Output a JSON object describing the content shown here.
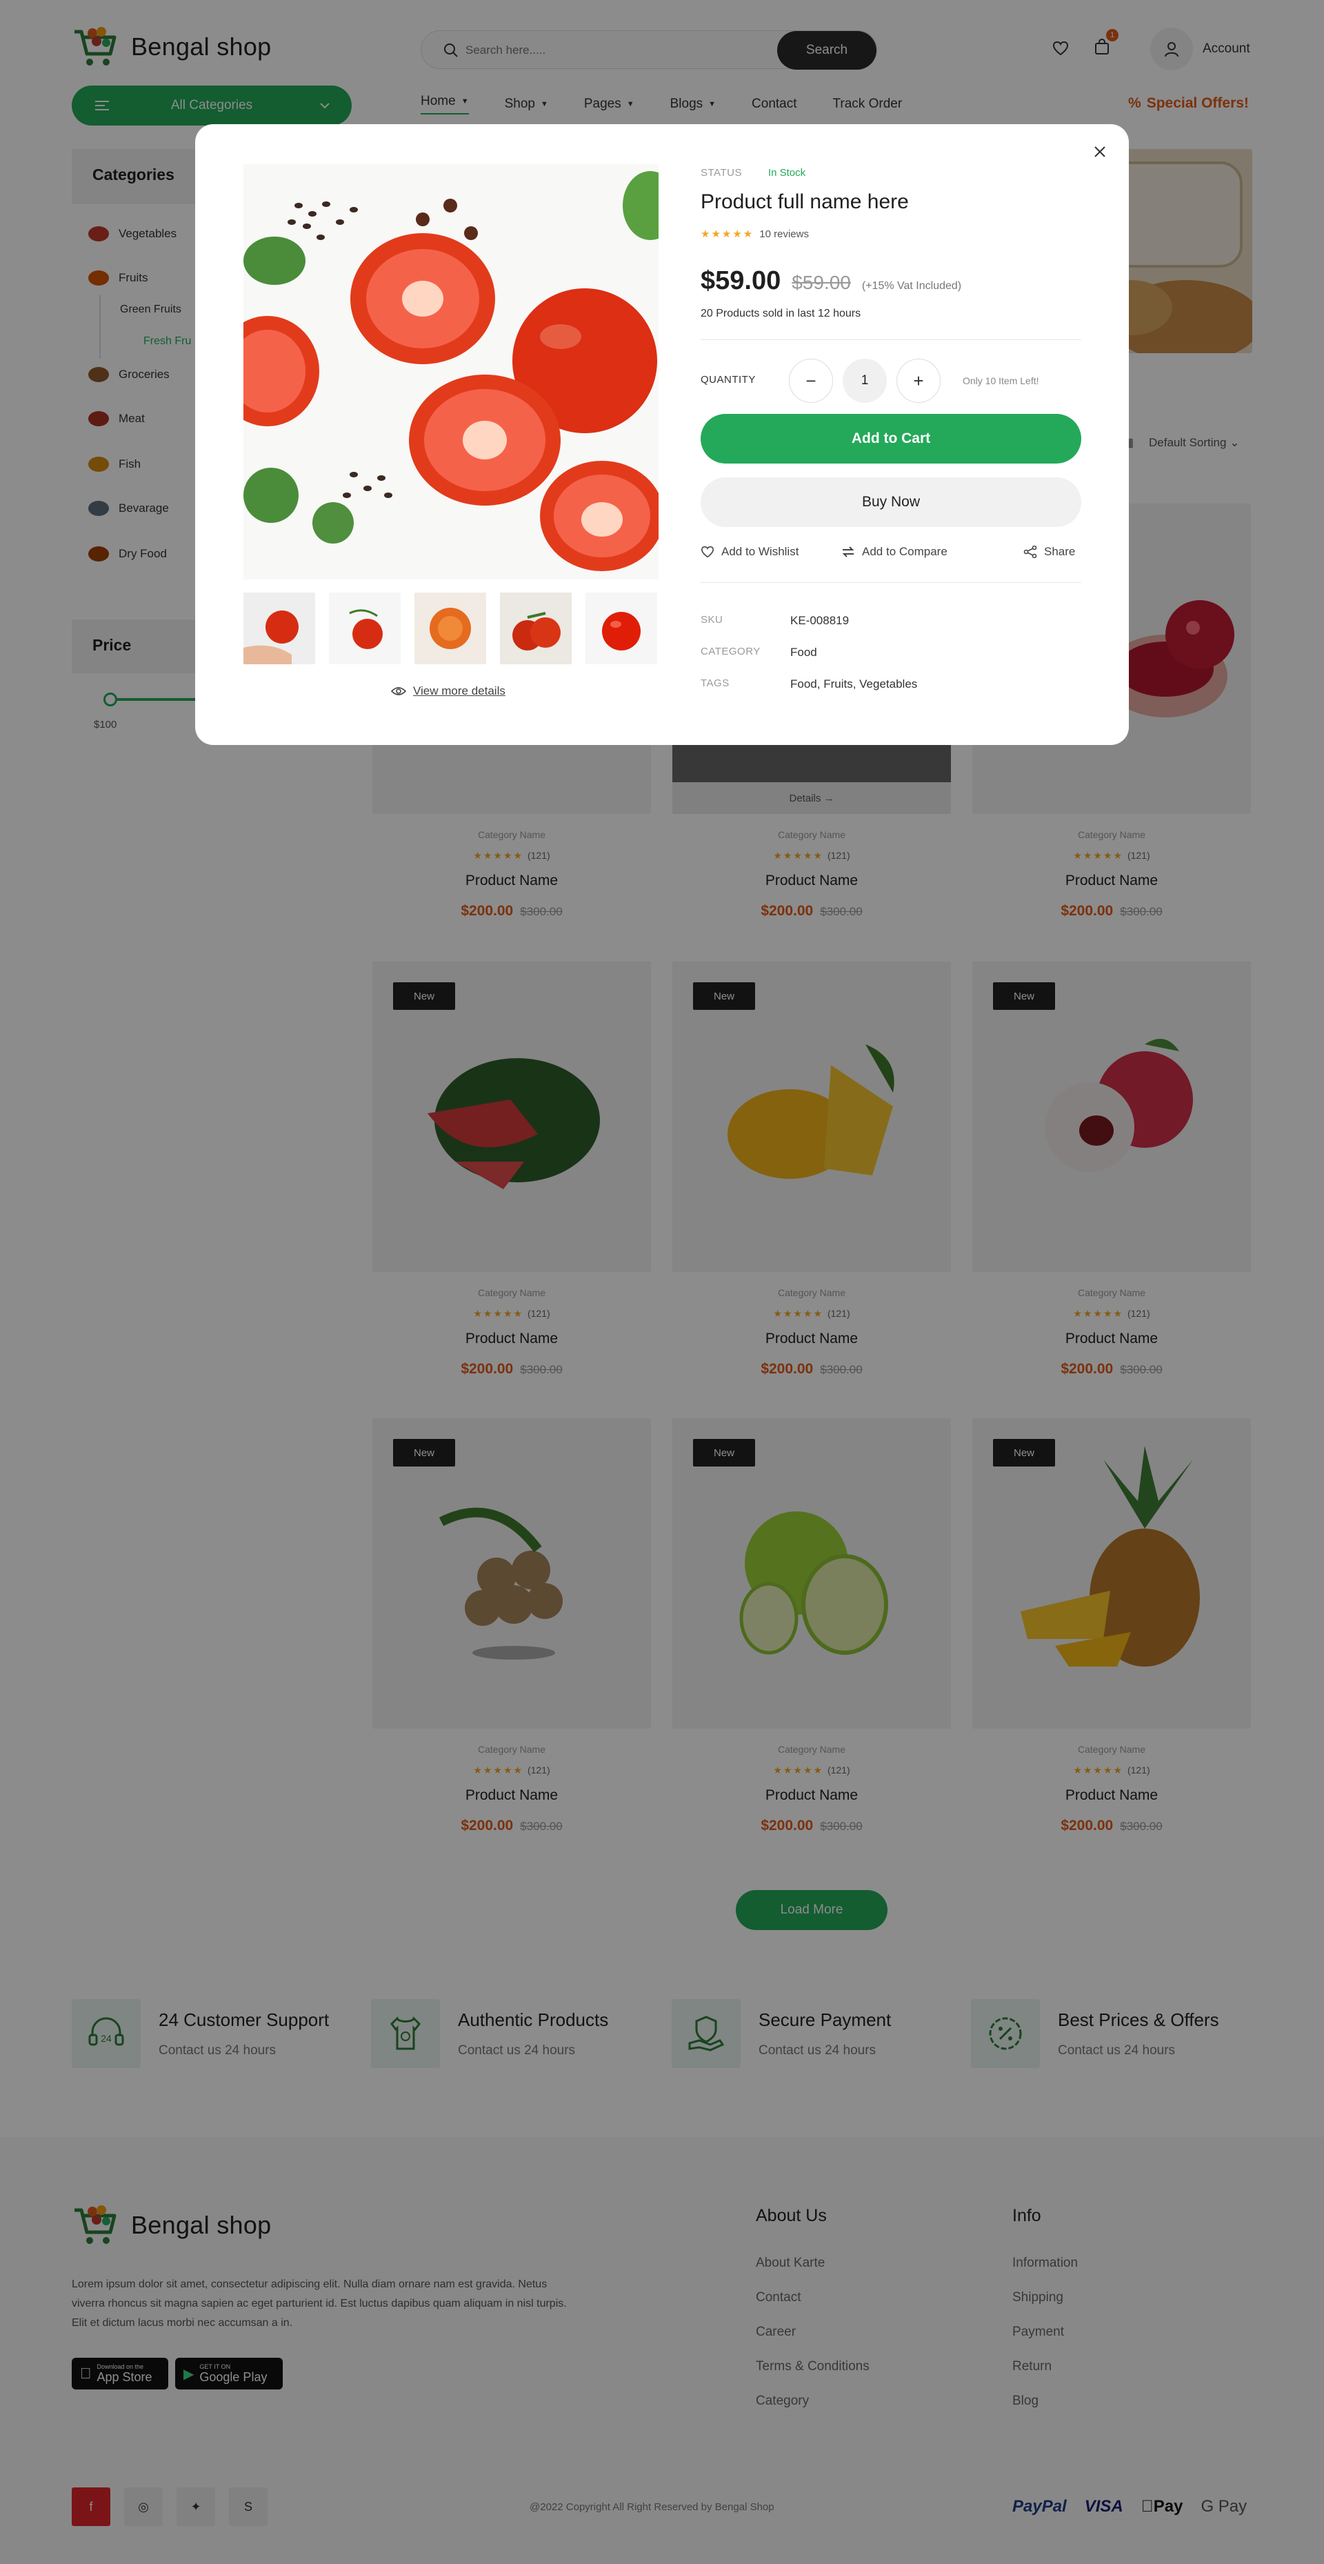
{
  "header": {
    "brand": "Bengal shop",
    "search_placeholder": "Search here.....",
    "search_button": "Search",
    "cart_count": "1",
    "account_label": "Account",
    "all_categories": "All Categories",
    "nav": [
      {
        "label": "Home",
        "dropdown": true
      },
      {
        "label": "Shop",
        "dropdown": true
      },
      {
        "label": "Pages",
        "dropdown": true
      },
      {
        "label": "Blogs",
        "dropdown": true
      },
      {
        "label": "Track Order",
        "dropdown": false
      }
    ],
    "special_offers": "Special Offers!"
  },
  "sidebar": {
    "categories_title": "Categories",
    "categories": [
      {
        "label": "Vegetables",
        "color": "#c0392b"
      },
      {
        "label": "Fruits",
        "color": "#d35400"
      },
      {
        "label": "Green Fruits"
      },
      {
        "label": "Fresh Fru",
        "active": true
      },
      {
        "label": "Groceries",
        "color": "#8e5a2b"
      },
      {
        "label": "Meat",
        "color": "#a93226"
      },
      {
        "label": "Fish",
        "color": "#d68910"
      },
      {
        "label": "Bevarage",
        "color": "#5d6d7e"
      },
      {
        "label": "Dry Food",
        "color": "#a04000"
      }
    ],
    "price_title": "Price",
    "price_min": "$100"
  },
  "toolbar": {
    "sort_label": "Default Sorting"
  },
  "products": {
    "category": "Category Name",
    "reviews": "(121)",
    "name": "Product Name",
    "price": "$200.00",
    "old_price": "$300.00",
    "badge": "New",
    "details": "Details →",
    "rows": [
      [
        "",
        "",
        "pomegranate"
      ],
      [
        "watermelon",
        "mango",
        "lychee"
      ],
      [
        "longan",
        "apple",
        "pineapple"
      ]
    ]
  },
  "load_more": "Load More",
  "features": [
    {
      "title": "24 Customer Support",
      "subtitle": "Contact us 24 hours",
      "icon": "headset-icon"
    },
    {
      "title": "Authentic Products",
      "subtitle": "Contact us 24 hours",
      "icon": "shirt-icon"
    },
    {
      "title": "Secure Payment",
      "subtitle": "Contact us 24 hours",
      "icon": "secure-hand-icon"
    },
    {
      "title": "Best Prices & Offers",
      "subtitle": "Contact us 24 hours",
      "icon": "percent-badge-icon"
    }
  ],
  "footer": {
    "brand": "Bengal shop",
    "description": "Lorem ipsum dolor sit amet, consectetur adipiscing elit. Nulla diam ornare nam est gravida. Netus viverra rhoncus sit magna sapien ac eget parturient id. Est luctus dapibus quam aliquam in nisl turpis. Elit et dictum lacus morbi nec accumsan a in.",
    "app_store": {
      "small": "Download on the",
      "big": "App Store"
    },
    "google_play": {
      "small": "GET IT ON",
      "big": "Google Play"
    },
    "about_title": "About Us",
    "about_links": [
      "About Karte",
      "Contact",
      "Career",
      "Terms & Conditions",
      "Category"
    ],
    "info_title": "Info",
    "info_links": [
      "Information",
      "Shipping",
      "Payment",
      "Return",
      "Blog"
    ],
    "copyright": "@2022 Copyright All Right Reserved by Bengal Shop",
    "payments": [
      "PayPal",
      "VISA",
      "Pay",
      "G Pay"
    ]
  },
  "modal": {
    "status_label": "STATUS",
    "status_value": "In Stock",
    "title": "Product full name here",
    "reviews": "10 reviews",
    "price": "$59.00",
    "old_price": "$59.00",
    "vat": "(+15% Vat Included)",
    "sold": "20 Products sold in last 12 hours",
    "quantity_label": "QUANTITY",
    "quantity": "1",
    "stock_note": "Only 10 Item Left!",
    "add_to_cart": "Add to Cart",
    "buy_now": "Buy Now",
    "wishlist": "Add to Wishlist",
    "compare": "Add to Compare",
    "share": "Share",
    "sku_label": "SKU",
    "sku": "KE-008819",
    "category_label": "CATEGORY",
    "category": "Food",
    "tags_label": "TAGS",
    "tags": "Food, Fruits, Vegetables",
    "view_more": "View more details"
  },
  "colors": {
    "accent": "#24a95a",
    "price": "#e05a19",
    "dark": "#2a2a2a"
  }
}
